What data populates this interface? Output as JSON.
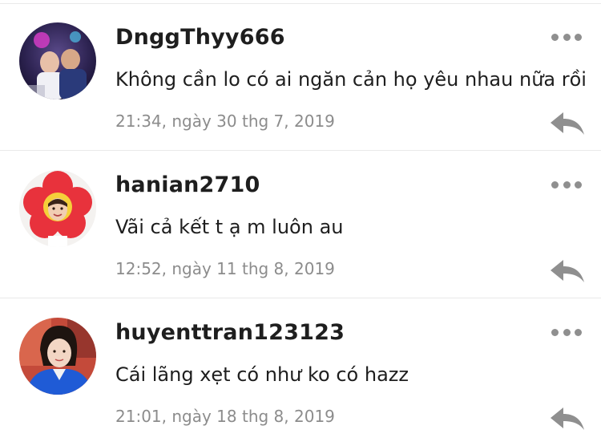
{
  "comments": [
    {
      "username": "DnggThyy666",
      "text": "Không cần lo có ai ngăn cản họ yêu nhau nữa rồi",
      "timestamp": "21:34, ngày 30 thg 7, 2019",
      "avatar_icon": "user-photo-avatar"
    },
    {
      "username": "hanian2710",
      "text": "Vãi cả kết t ạ m luôn au",
      "timestamp": "12:52, ngày 11 thg 8, 2019",
      "avatar_icon": "flower-costume-avatar"
    },
    {
      "username": "huyenttran123123",
      "text": "Cái lãng xẹt có như ko có hazz",
      "timestamp": "21:01, ngày 18 thg 8, 2019",
      "avatar_icon": "user-photo-avatar"
    }
  ],
  "icons": {
    "more": "more-options-icon",
    "reply": "reply-arrow-icon"
  },
  "colors": {
    "username": "#1e1e1e",
    "timestamp": "#8c8c8c",
    "icon_gray": "#8f8f8f",
    "divider": "#e9e9e9"
  }
}
